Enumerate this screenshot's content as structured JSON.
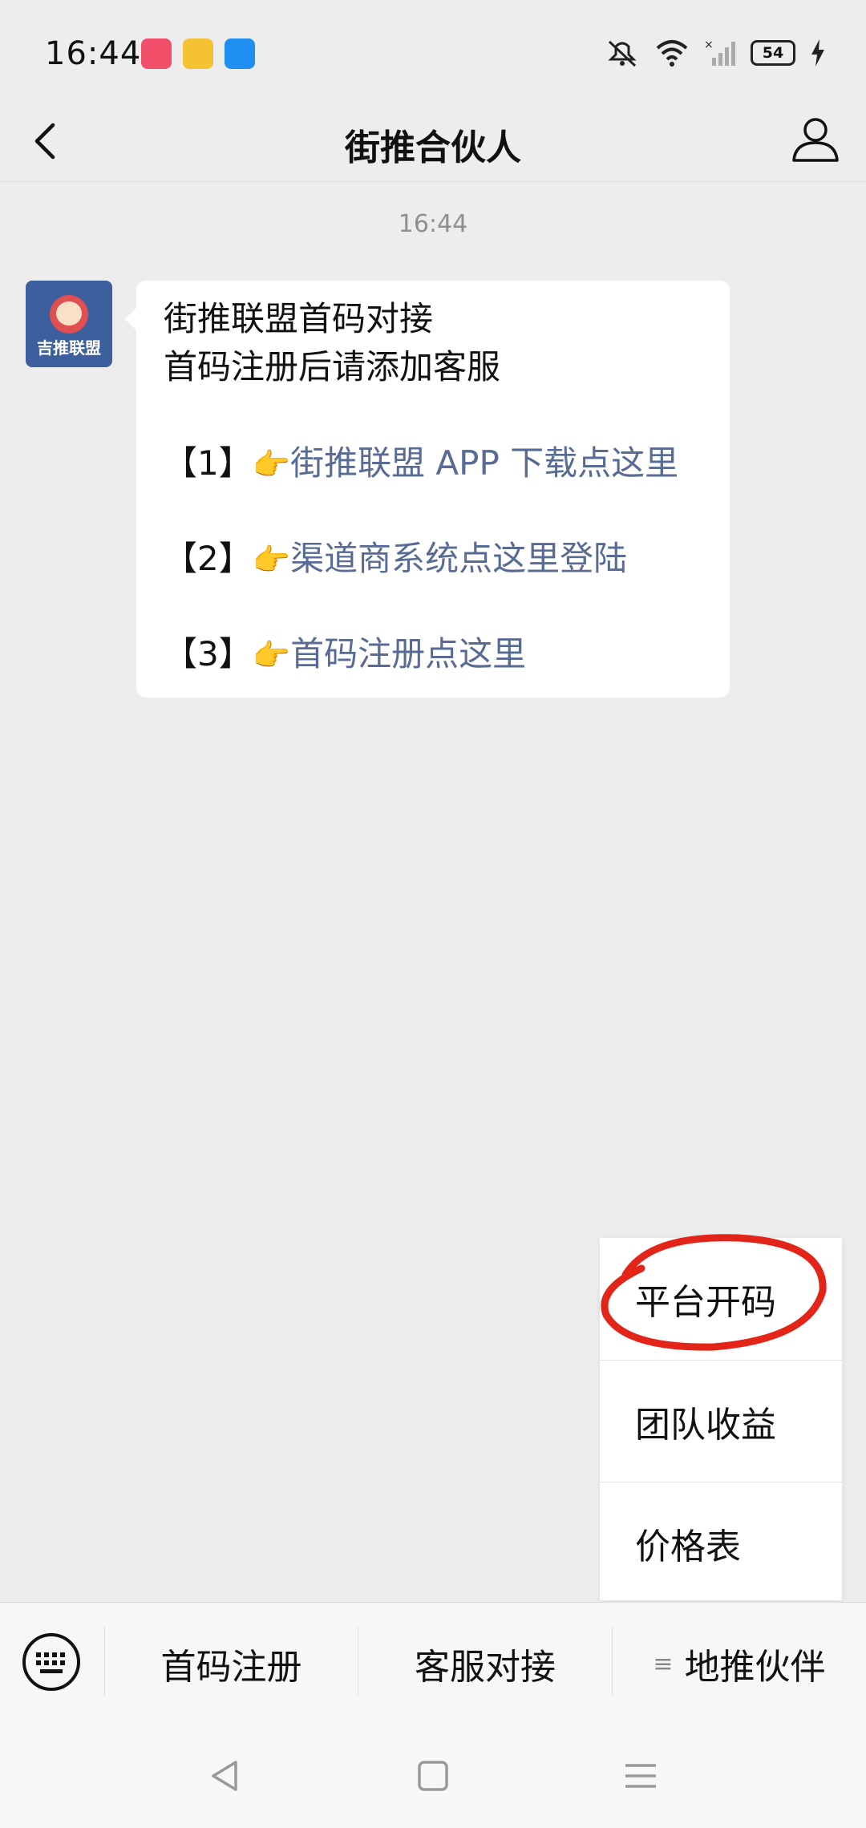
{
  "status_bar": {
    "time": "16:44",
    "battery": "54"
  },
  "header": {
    "title": "街推合伙人"
  },
  "chat": {
    "timestamp": "16:44",
    "avatar_label": "吉推联盟",
    "message": {
      "line1": "街推联盟首码对接",
      "line2": "首码注册后请添加客服",
      "items": [
        {
          "prefix": "【1】",
          "hand": "👉",
          "link": "街推联盟 APP 下载点这里"
        },
        {
          "prefix": "【2】",
          "hand": "👉",
          "link": "渠道商系统点这里登陆"
        },
        {
          "prefix": "【3】",
          "hand": "👉",
          "link": "首码注册点这里"
        }
      ]
    }
  },
  "popup_menu": {
    "items": [
      "平台开码",
      "团队收益",
      "价格表"
    ]
  },
  "bottom_menu": {
    "items": [
      "首码注册",
      "客服对接",
      "地推伙伴"
    ],
    "submenu_icon": "≡"
  },
  "colors": {
    "link": "#576b95",
    "background": "#ededed",
    "annotation": "#e32418"
  }
}
